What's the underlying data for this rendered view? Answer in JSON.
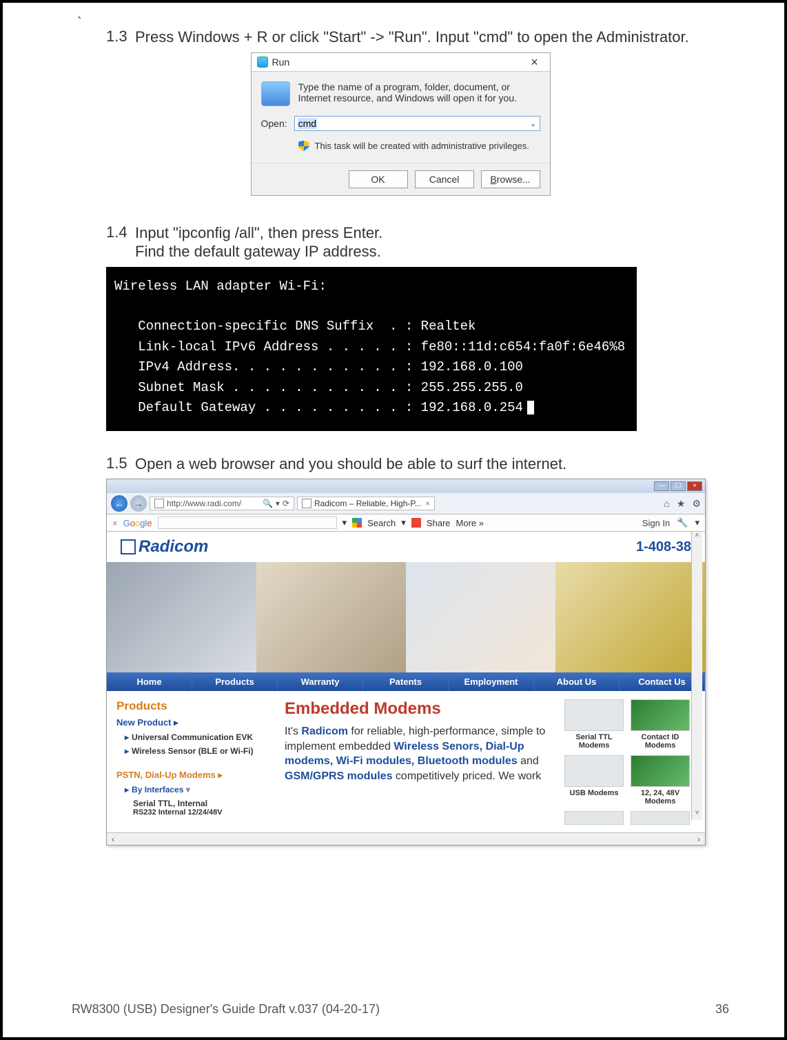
{
  "backtick": "`",
  "steps": {
    "s13": {
      "num": "1.3",
      "text": "Press Windows + R or click \"Start\" -> \"Run\".    Input \"cmd\" to open the Administrator."
    },
    "s14": {
      "num": "1.4",
      "line1": "Input \"ipconfig /all\", then press Enter.",
      "line2": "Find the default gateway IP address."
    },
    "s15": {
      "num": "1.5",
      "text": "Open a web browser and you should be able to surf the internet."
    }
  },
  "run": {
    "title": "Run",
    "close": "×",
    "desc": "Type the name of a program, folder, document, or Internet resource, and Windows will open it for you.",
    "openLabel": "Open:",
    "value": "cmd",
    "priv": "This task will be created with administrative privileges.",
    "ok": "OK",
    "cancel": "Cancel",
    "browse": "Browse..."
  },
  "cmd": {
    "l0": "Wireless LAN adapter Wi-Fi:",
    "l1": "   Connection-specific DNS Suffix  . : Realtek",
    "l2": "   Link-local IPv6 Address . . . . . : fe80::11d:c654:fa0f:6e46%8",
    "l3": "   IPv4 Address. . . . . . . . . . . : 192.168.0.100",
    "l4": "   Subnet Mask . . . . . . . . . . . : 255.255.255.0",
    "l5": "   Default Gateway . . . . . . . . . : 192.168.0.254"
  },
  "browser": {
    "url": "http://www.radi.com/",
    "refresh": "⟳",
    "search": "🔍",
    "tab": "Radicom – Reliable, High-P...",
    "icons": {
      "home": "⌂",
      "star": "★",
      "gear": "⚙"
    },
    "google": {
      "x": "×",
      "searchLbl": "Search",
      "share": "Share",
      "more": "More »",
      "signin": "Sign In"
    },
    "logo": "Radicom",
    "phone": "1-408-38",
    "nav": [
      "Home",
      "Products",
      "Warranty",
      "Patents",
      "Employment",
      "About Us",
      "Contact Us"
    ],
    "left": {
      "products": "Products",
      "newprod": "New Product ▸",
      "evk": "Universal Communication EVK",
      "sensor": "Wireless Sensor (BLE or Wi-Fi)",
      "pstn": "PSTN, Dial-Up Modems ▸",
      "byint": "By Interfaces",
      "serial": "Serial TTL, Internal",
      "rs232": "RS232  Internal  12/24/48V"
    },
    "mid": {
      "title": "Embedded Modems",
      "t1": "It's ",
      "radicom": "Radicom",
      "t2": " for reliable, high-performance, simple to implement embedded ",
      "l1": "Wireless Senors, Dial-Up modems, Wi-Fi modules, Bluetooth modules",
      "t3": " and ",
      "l2": "GSM/GPRS modules",
      "t4": " competitively priced.  We work"
    },
    "right": {
      "b1": "Serial TTL Modems",
      "b2": "Contact ID Modems",
      "b3": "USB Modems",
      "b4": "12, 24, 48V Modems"
    }
  },
  "footer": {
    "left": "RW8300 (USB) Designer's Guide Draft v.037 (04-20-17)",
    "right": "36"
  }
}
